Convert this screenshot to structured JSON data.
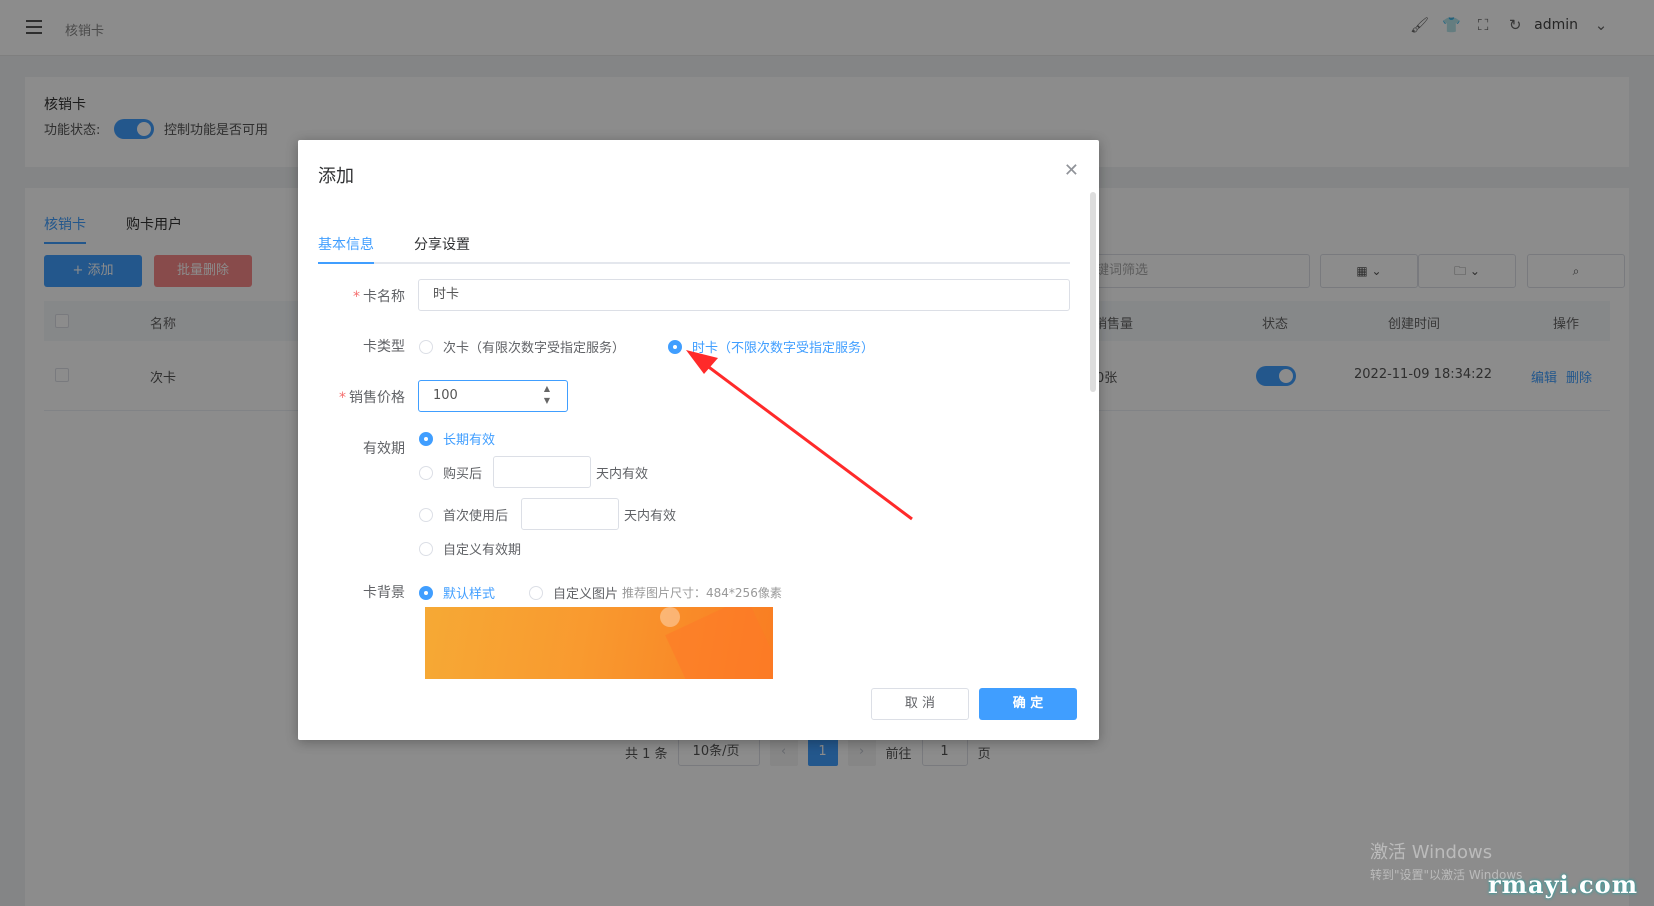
{
  "header": {
    "breadcrumb": "核销卡",
    "user": "admin"
  },
  "settings_card": {
    "title": "核销卡",
    "status_label": "功能状态:",
    "status_desc": "控制功能是否可用"
  },
  "list": {
    "tabs": [
      "核销卡",
      "购卡用户"
    ],
    "add_button": "+ 添加",
    "batch_delete_button": "批量删除",
    "filter_placeholder": "键词筛选",
    "columns": {
      "name": "名称",
      "sold": "销售量",
      "status": "状态",
      "created": "创建时间",
      "actions": "操作"
    },
    "rows": [
      {
        "name": "次卡",
        "sold": "0张",
        "created": "2022-11-09 18:34:22",
        "edit": "编辑",
        "delete": "删除"
      }
    ]
  },
  "pagination": {
    "total": "共 1 条",
    "page_size": "10条/页",
    "current": "1",
    "goto_label": "前往",
    "goto_value": "1",
    "page_suffix": "页"
  },
  "dialog": {
    "title": "添加",
    "tabs": [
      "基本信息",
      "分享设置"
    ],
    "fields": {
      "card_name_label": "卡名称",
      "card_name_value": "时卡",
      "card_type_label": "卡类型",
      "card_type_options": [
        "次卡（有限次数字受指定服务）",
        "时卡（不限次数字受指定服务）"
      ],
      "price_label": "销售价格",
      "price_value": "100",
      "validity_label": "有效期",
      "validity_long": "长期有效",
      "validity_after_buy": "购买后",
      "validity_after_first_use": "首次使用后",
      "validity_days_suffix": "天内有效",
      "validity_custom": "自定义有效期",
      "bg_label": "卡背景",
      "bg_default": "默认样式",
      "bg_custom": "自定义图片",
      "bg_hint": "推荐图片尺寸：484*256像素"
    },
    "cancel": "取 消",
    "confirm": "确 定"
  },
  "watermark": {
    "windows_line1": "激活 Windows",
    "windows_line2": "转到\"设置\"以激活 Windows",
    "brand": "rmayi.com"
  },
  "colors": {
    "primary": "#409eff",
    "danger": "#f56c6c",
    "annotation_arrow": "#ff2a2a"
  }
}
